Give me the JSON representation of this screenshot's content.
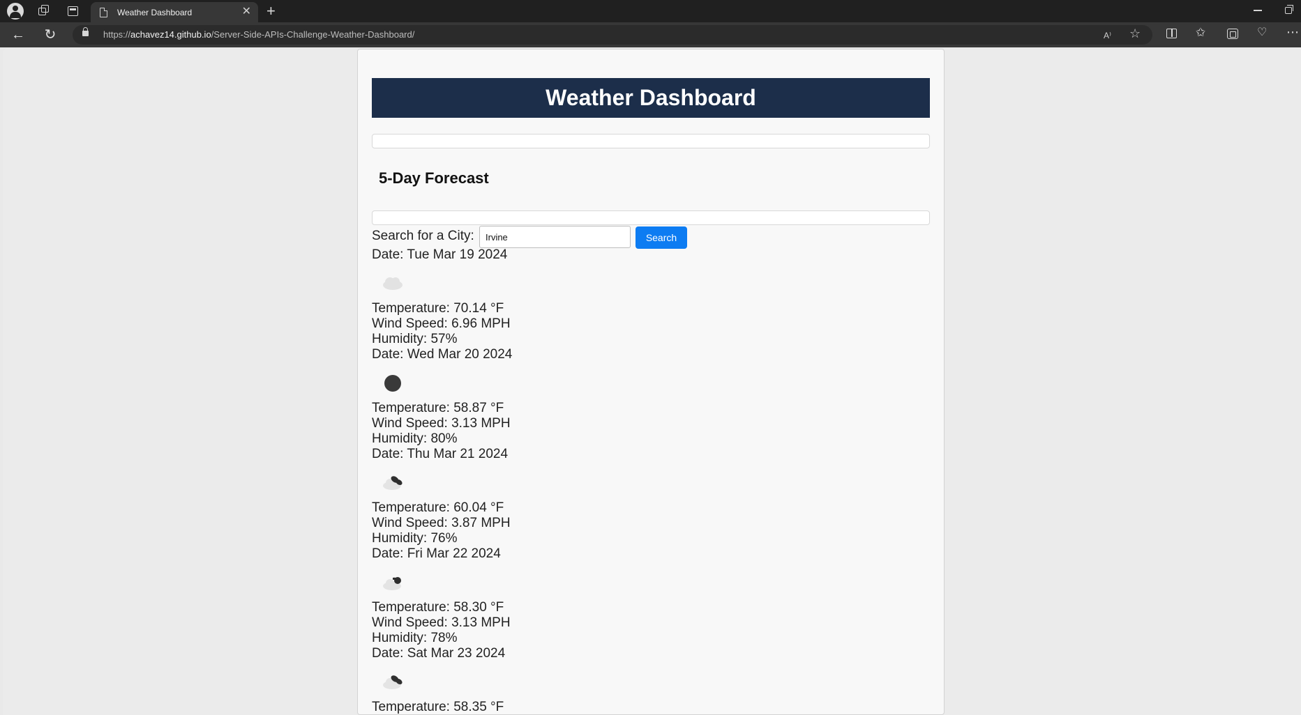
{
  "browser": {
    "tab_title": "Weather Dashboard",
    "url_scheme": "https://",
    "url_host": "achavez14.github.io",
    "url_path": "/Server-Side-APIs-Challenge-Weather-Dashboard/",
    "read_aloud_icon": "A⁾",
    "favorite_icon": "☆",
    "favorites_icon": "✩",
    "more_icon": "⋯"
  },
  "app": {
    "title": "Weather Dashboard",
    "forecast_heading": "5-Day Forecast"
  },
  "search": {
    "label": "Search for a City:",
    "value": "Irvine",
    "button_label": "Search"
  },
  "forecast": [
    {
      "date": "Date: Tue Mar 19 2024",
      "icon": "cloud-icon",
      "temperature": "Temperature: 70.14 °F",
      "wind": "Wind Speed: 6.96 MPH",
      "humidity": "Humidity: 57%"
    },
    {
      "date": "Date: Wed Mar 20 2024",
      "icon": "clear-night-icon",
      "temperature": "Temperature: 58.87 °F",
      "wind": "Wind Speed: 3.13 MPH",
      "humidity": "Humidity: 80%"
    },
    {
      "date": "Date: Thu Mar 21 2024",
      "icon": "broken-clouds-icon",
      "temperature": "Temperature: 60.04 °F",
      "wind": "Wind Speed: 3.87 MPH",
      "humidity": "Humidity: 76%"
    },
    {
      "date": "Date: Fri Mar 22 2024",
      "icon": "partly-cloudy-icon",
      "temperature": "Temperature: 58.30 °F",
      "wind": "Wind Speed: 3.13 MPH",
      "humidity": "Humidity: 78%"
    },
    {
      "date": "Date: Sat Mar 23 2024",
      "icon": "broken-clouds-icon",
      "temperature": "Temperature: 58.35 °F",
      "wind": "",
      "humidity": ""
    }
  ],
  "colors": {
    "header_bg": "#1c2e4a",
    "button_bg": "#0d7cf2",
    "page_bg": "#f8f8f8"
  }
}
